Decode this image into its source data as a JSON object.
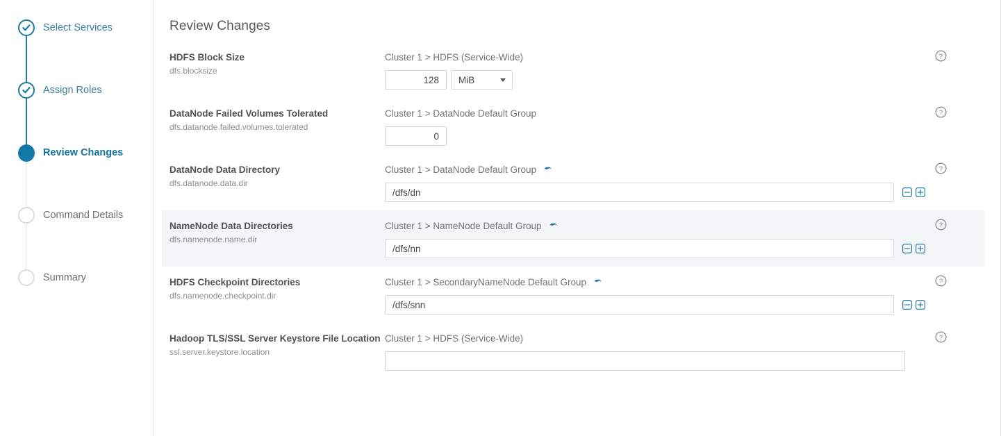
{
  "colors": {
    "accent": "#1279a8",
    "step_done": "#1f7a9e",
    "step_todo": "#dcdcdc",
    "highlight_row_bg": "#f4f5f6",
    "label_text": "#4f5356",
    "muted_text": "#8a8f93"
  },
  "sidebar": {
    "steps": [
      {
        "label": "Select Services",
        "state": "done",
        "icon": "check-circle-icon"
      },
      {
        "label": "Assign Roles",
        "state": "done",
        "icon": "check-circle-icon"
      },
      {
        "label": "Review Changes",
        "state": "active",
        "icon": "filled-circle-icon"
      },
      {
        "label": "Command Details",
        "state": "todo",
        "icon": "empty-circle-icon"
      },
      {
        "label": "Summary",
        "state": "todo",
        "icon": "empty-circle-icon"
      }
    ]
  },
  "main": {
    "title": "Review Changes",
    "help_icon": "question-circle-icon",
    "undo_icon": "undo-arrow-icon",
    "minus_icon": "minus-square-icon",
    "plus_icon": "plus-square-icon",
    "rows": [
      {
        "name": "HDFS Block Size",
        "key": "dfs.blocksize",
        "scope": "Cluster 1 > HDFS (Service-Wide)",
        "has_undo": false,
        "value": "128",
        "unit": "MiB",
        "highlighted": false
      },
      {
        "name": "DataNode Failed Volumes Tolerated",
        "key": "dfs.datanode.failed.volumes.tolerated",
        "scope": "Cluster 1 > DataNode Default Group",
        "has_undo": false,
        "value": "0",
        "highlighted": false
      },
      {
        "name": "DataNode Data Directory",
        "key": "dfs.datanode.data.dir",
        "scope": "Cluster 1 > DataNode Default Group",
        "has_undo": true,
        "value": "/dfs/dn",
        "highlighted": false
      },
      {
        "name": "NameNode Data Directories",
        "key": "dfs.namenode.name.dir",
        "scope": "Cluster 1 > NameNode Default Group",
        "has_undo": true,
        "value": "/dfs/nn",
        "highlighted": true
      },
      {
        "name": "HDFS Checkpoint Directories",
        "key": "dfs.namenode.checkpoint.dir",
        "scope": "Cluster 1 > SecondaryNameNode Default Group",
        "has_undo": true,
        "value": "/dfs/snn",
        "highlighted": false
      },
      {
        "name": "Hadoop TLS/SSL Server Keystore File Location",
        "key": "ssl.server.keystore.location",
        "scope": "Cluster 1 > HDFS (Service-Wide)",
        "has_undo": false,
        "value": "",
        "highlighted": false
      }
    ]
  }
}
